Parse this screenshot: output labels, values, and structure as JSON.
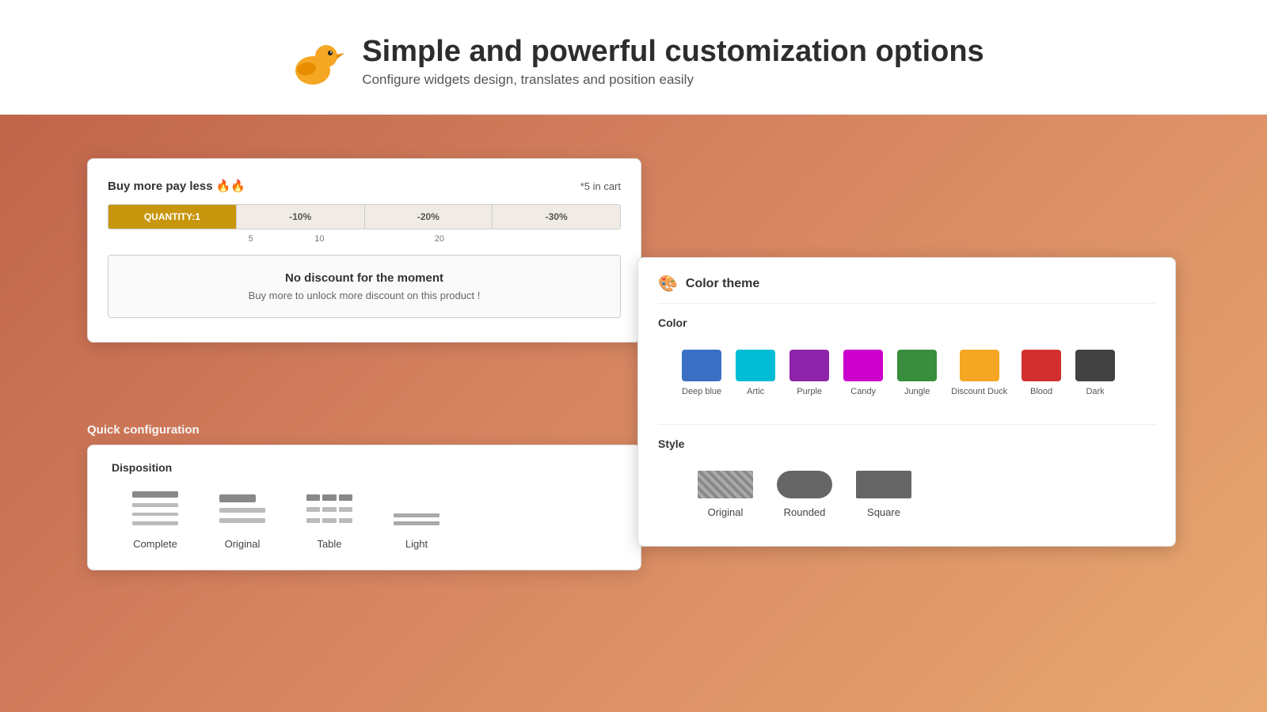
{
  "header": {
    "title": "Simple and powerful customization options",
    "subtitle": "Configure widgets design, translates and position easily"
  },
  "widget": {
    "buy_more_label": "Buy more pay less 🔥🔥",
    "cart_label": "*5 in cart",
    "quantity_label": "QUANTITY:1",
    "discount_10": "-10%",
    "discount_20": "-20%",
    "discount_30": "-30%",
    "qty_5": "5",
    "qty_10": "10",
    "qty_20": "20",
    "no_discount_title": "No discount for the moment",
    "no_discount_sub": "Buy more to unlock more discount on this product !"
  },
  "quick_config": {
    "section_title": "Quick configuration",
    "disposition_title": "Disposition",
    "options": [
      {
        "id": "complete",
        "label": "Complete"
      },
      {
        "id": "original",
        "label": "Original"
      },
      {
        "id": "table",
        "label": "Table"
      },
      {
        "id": "light",
        "label": "Light"
      }
    ]
  },
  "color_panel": {
    "title": "Color theme",
    "color_section_label": "Color",
    "colors": [
      {
        "name": "Deep blue",
        "hex": "#3a6fc4"
      },
      {
        "name": "Artic",
        "hex": "#00bcd4"
      },
      {
        "name": "Purple",
        "hex": "#8e24aa"
      },
      {
        "name": "Candy",
        "hex": "#cc00cc"
      },
      {
        "name": "Jungle",
        "hex": "#388e3c"
      },
      {
        "name": "Discount Duck",
        "hex": "#f5a623"
      },
      {
        "name": "Blood",
        "hex": "#d32f2f"
      },
      {
        "name": "Dark",
        "hex": "#424242"
      }
    ],
    "style_section_label": "Style",
    "styles": [
      {
        "id": "original",
        "label": "Original"
      },
      {
        "id": "rounded",
        "label": "Rounded"
      },
      {
        "id": "square",
        "label": "Square"
      }
    ]
  }
}
